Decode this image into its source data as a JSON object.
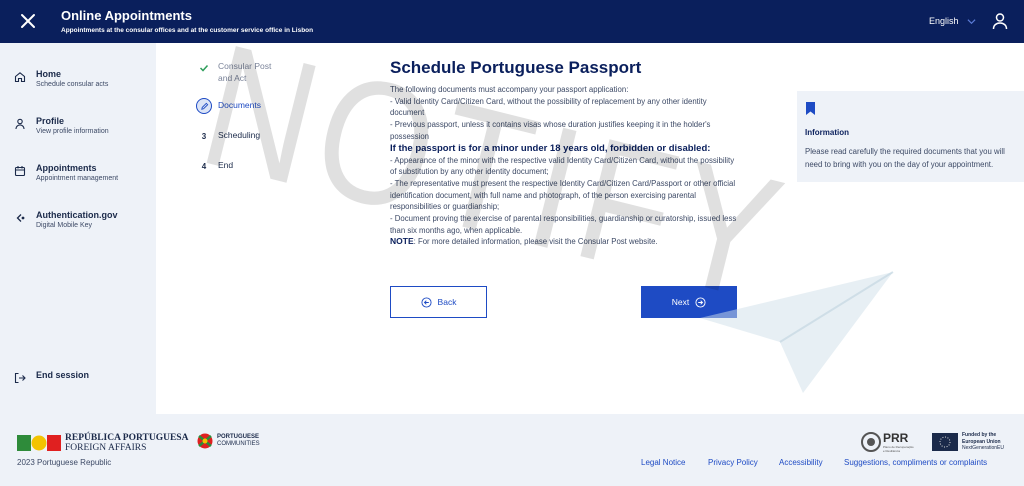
{
  "header": {
    "title": "Online Appointments",
    "subtitle": "Appointments at the consular offices and at the customer service office in Lisbon",
    "language": "English",
    "close_icon": "close-icon",
    "user_icon": "user-icon"
  },
  "sidebar": {
    "items": [
      {
        "label": "Home",
        "sub": "Schedule consular acts",
        "icon": "home-icon"
      },
      {
        "label": "Profile",
        "sub": "View profile information",
        "icon": "person-icon"
      },
      {
        "label": "Appointments",
        "sub": "Appointment management",
        "icon": "calendar-icon"
      },
      {
        "label": "Authentication.gov",
        "sub": "Digital Mobile Key",
        "icon": "key-icon"
      }
    ],
    "end_session": "End session"
  },
  "steps": [
    {
      "num": "",
      "label": "Consular Post and Act",
      "state": "done"
    },
    {
      "num": "",
      "label": "Documents",
      "state": "active"
    },
    {
      "num": "3",
      "label": "Scheduling",
      "state": "todo"
    },
    {
      "num": "4",
      "label": "End",
      "state": "todo"
    }
  ],
  "content": {
    "title": "Schedule Portuguese Passport",
    "intro": "The following documents must accompany your passport application:",
    "line1": "- Valid Identity Card/Citizen Card, without the possibility of replacement by any other identity document",
    "line2": "- Previous passport, unless it contains visas whose duration justifies keeping it in the holder's possession",
    "minor_heading": "If the passport is for a minor under 18 years old, forbidden or disabled:",
    "line3": "- Appearance of the minor with the respective valid Identity Card/Citizen Card, without the possibility of substitution by any other identity document;",
    "line4": "- The representative must present the respective Identity Card/Citizen Card/Passport or other official identification document, with full name and photograph, of the person exercising parental responsibilities or guardianship;",
    "line5": "- Document proving the exercise of parental responsibilities, guardianship or curatorship, issued less than six months ago, when applicable.",
    "note_label": "NOTE",
    "note_text": ": For more detailed information, please visit the Consular Post website.",
    "back_label": "Back",
    "next_label": "Next"
  },
  "info": {
    "title": "Information",
    "body": "Please read carefully the required documents that you will need to bring with you on the day of your appointment."
  },
  "footer": {
    "logo_line1": "REPÚBLICA PORTUGUESA",
    "logo_line2": "FOREIGN AFFAIRS",
    "communities_line1": "PORTUGUESE",
    "communities_line2": "COMMUNITIES",
    "prr_label": "PRR",
    "prr_sub": "Plano de Recuperação e Resiliência",
    "eu_line1": "Funded by the",
    "eu_line2": "European Union",
    "eu_line3": "NextGenerationEU",
    "copyright": "2023 Portuguese Republic",
    "links": [
      "Legal Notice",
      "Privacy Policy",
      "Accessibility",
      "Suggestions, compliments or complaints"
    ]
  },
  "watermark": "NOTIFY",
  "colors": {
    "navy": "#0a1f5c",
    "accent": "#1e4bc4",
    "sidebar_bg": "#eef2f8",
    "done_green": "#2e9e5b"
  }
}
